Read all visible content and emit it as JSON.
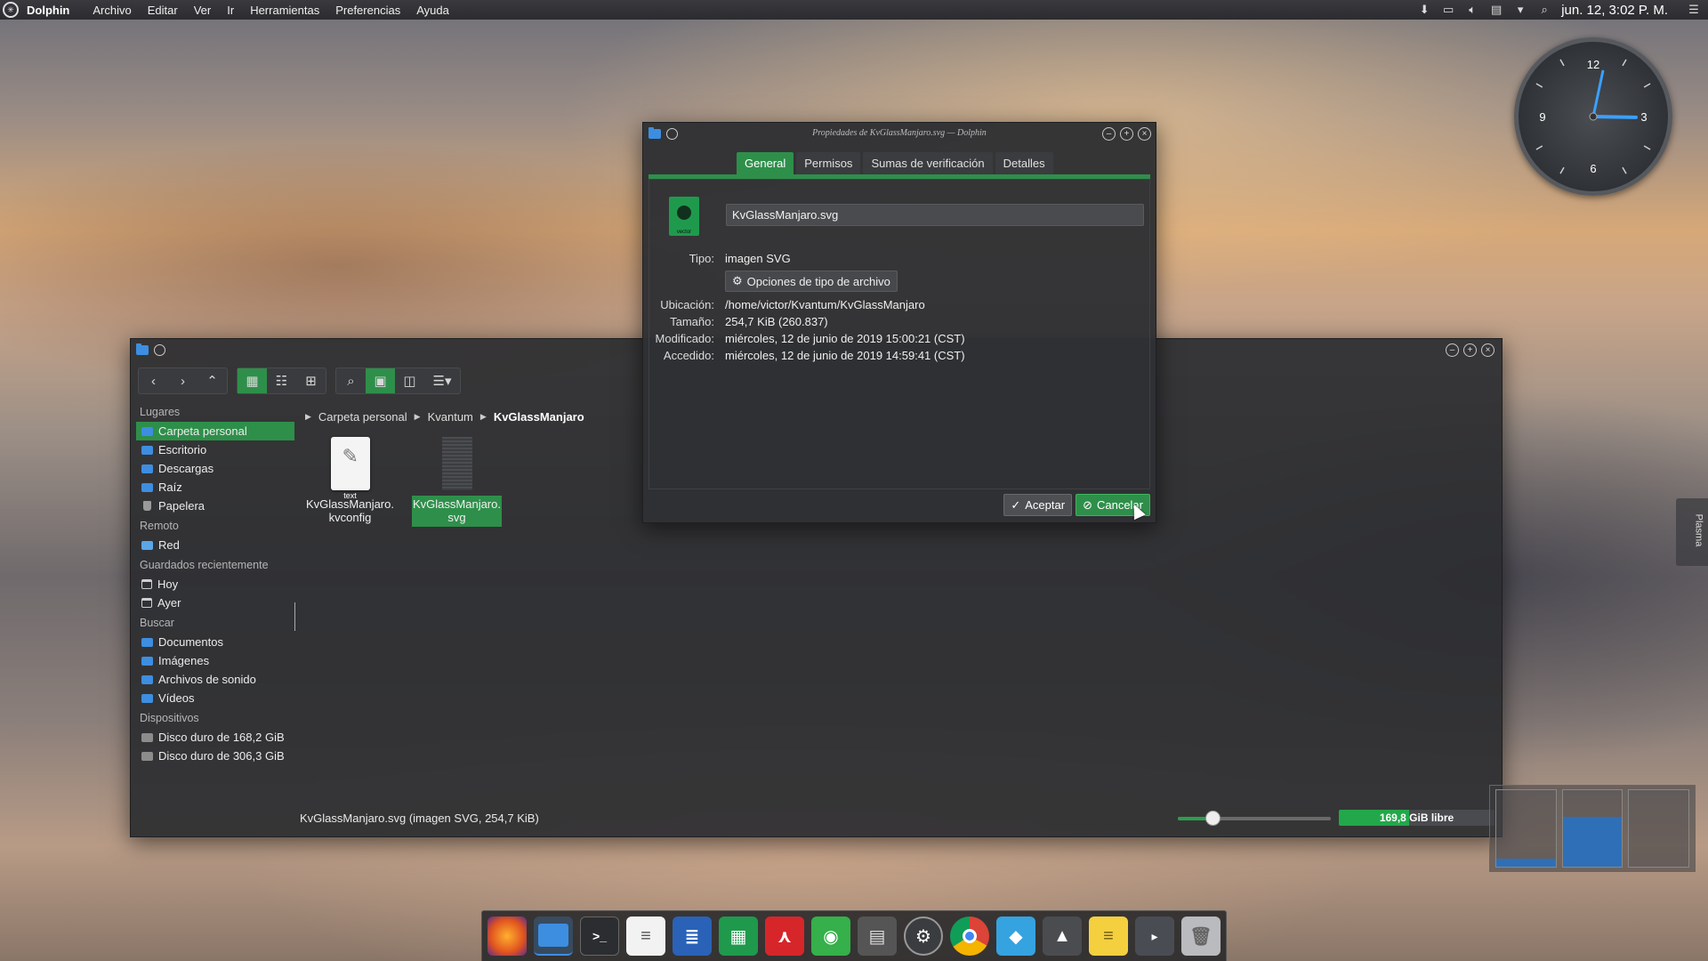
{
  "top_panel": {
    "app_name": "Dolphin",
    "menu": [
      "Archivo",
      "Editar",
      "Ver",
      "Ir",
      "Herramientas",
      "Preferencias",
      "Ayuda"
    ],
    "clock": "jun. 12, 3:02 P. M.",
    "tray_icons": [
      "download-icon",
      "display-icon",
      "volume-icon",
      "clipboard-icon",
      "arrow-down-icon",
      "search-icon"
    ]
  },
  "analog_clock": {
    "numerals": [
      "12",
      "3",
      "6",
      "9"
    ],
    "hour": 3,
    "minute": 2
  },
  "dolphin": {
    "sidebar": {
      "sections": [
        {
          "title": "Lugares",
          "items": [
            {
              "label": "Carpeta personal",
              "icon": "home-folder-icon",
              "selected": true
            },
            {
              "label": "Escritorio",
              "icon": "folder-icon"
            },
            {
              "label": "Descargas",
              "icon": "folder-icon"
            },
            {
              "label": "Raíz",
              "icon": "folder-icon"
            },
            {
              "label": "Papelera",
              "icon": "trash-icon"
            }
          ]
        },
        {
          "title": "Remoto",
          "items": [
            {
              "label": "Red",
              "icon": "network-icon"
            }
          ]
        },
        {
          "title": "Guardados recientemente",
          "items": [
            {
              "label": "Hoy",
              "icon": "calendar-icon"
            },
            {
              "label": "Ayer",
              "icon": "calendar-icon"
            }
          ]
        },
        {
          "title": "Buscar",
          "items": [
            {
              "label": "Documentos",
              "icon": "folder-icon"
            },
            {
              "label": "Imágenes",
              "icon": "folder-icon"
            },
            {
              "label": "Archivos de sonido",
              "icon": "folder-icon"
            },
            {
              "label": "Vídeos",
              "icon": "folder-icon"
            }
          ]
        },
        {
          "title": "Dispositivos",
          "items": [
            {
              "label": "Disco duro de 168,2 GiB",
              "icon": "disk-icon"
            },
            {
              "label": "Disco duro de 306,3 GiB",
              "icon": "disk-icon"
            }
          ]
        }
      ]
    },
    "breadcrumb": [
      "Carpeta personal",
      "Kvantum",
      "KvGlassManjaro"
    ],
    "files": [
      {
        "name_line1": "KvGlassManjaro.",
        "name_line2": "kvconfig",
        "thumb_label": "text",
        "selected": false
      },
      {
        "name_line1": "KvGlassManjaro.",
        "name_line2": "svg",
        "selected": true
      }
    ],
    "status": "KvGlassManjaro.svg (imagen SVG, 254,7 KiB)",
    "zoom_fraction": 0.23,
    "free_space": "169,8 GiB libre",
    "used_fraction": 0.45
  },
  "props": {
    "title": "Propiedades de KvGlassManjaro.svg — Dolphin",
    "tabs": [
      "General",
      "Permisos",
      "Sumas de verificación",
      "Detalles"
    ],
    "file_name": "KvGlassManjaro.svg",
    "icon_label": "vector",
    "fields": {
      "tipo_label": "Tipo:",
      "tipo": "imagen SVG",
      "options_button": "Opciones de tipo de archivo",
      "ubicacion_label": "Ubicación:",
      "ubicacion": "/home/victor/Kvantum/KvGlassManjaro",
      "tamano_label": "Tamaño:",
      "tamano": "254,7 KiB (260.837)",
      "modificado_label": "Modificado:",
      "modificado": "miércoles, 12 de junio de 2019 15:00:21 (CST)",
      "accedido_label": "Accedido:",
      "accedido": "miércoles, 12 de junio de 2019 14:59:41 (CST)"
    },
    "ok": "Aceptar",
    "cancel": "Cancelar"
  },
  "plasma_label": "Plasma",
  "pager_levels": [
    0.1,
    0.65,
    0.0
  ],
  "dock": [
    "firefox-icon",
    "file-manager-icon",
    "terminal-icon",
    "text-editor-icon",
    "writer-icon",
    "calc-icon",
    "pdf-icon",
    "screenshot-icon",
    "calculator-icon",
    "settings-icon",
    "chrome-icon",
    "package-icon",
    "inkscape-icon",
    "notes-icon",
    "remote-icon",
    "trash-icon"
  ]
}
